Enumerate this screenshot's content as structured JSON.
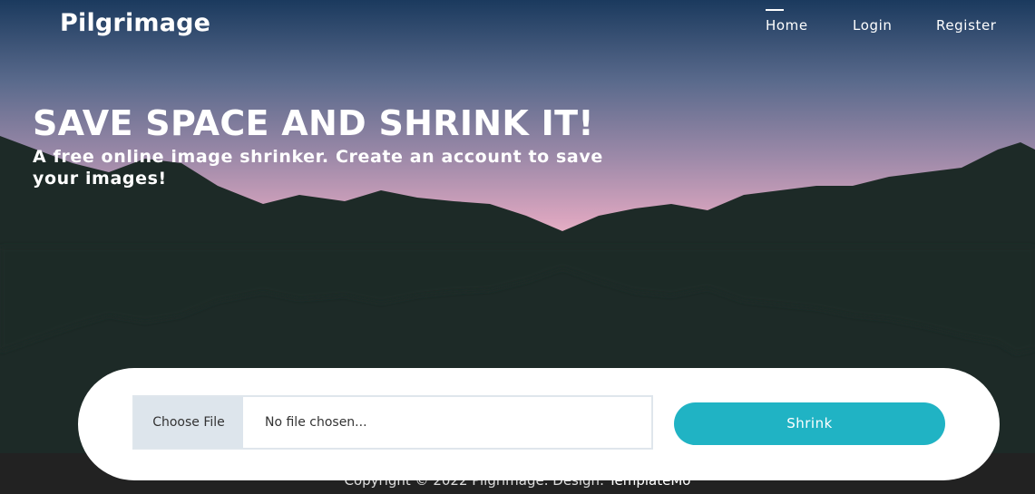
{
  "nav": {
    "brand": "Pilgrimage",
    "links": [
      {
        "label": "Home",
        "active": true
      },
      {
        "label": "Login",
        "active": false
      },
      {
        "label": "Register",
        "active": false
      }
    ]
  },
  "hero": {
    "headline": "SAVE SPACE AND SHRINK IT!",
    "subheadline": "A free online image shrinker. Create an account to save your images!"
  },
  "upload": {
    "choose_label": "Choose File",
    "file_status": "No file chosen...",
    "submit_label": "Shrink"
  },
  "footer": {
    "copyright": "Copyright © 2022 Pilgrimage. Design:",
    "credit": "TemplateMo"
  },
  "colors": {
    "accent": "#20b3c4",
    "footer_bg": "#222222",
    "mountain": "#1d2a27"
  }
}
